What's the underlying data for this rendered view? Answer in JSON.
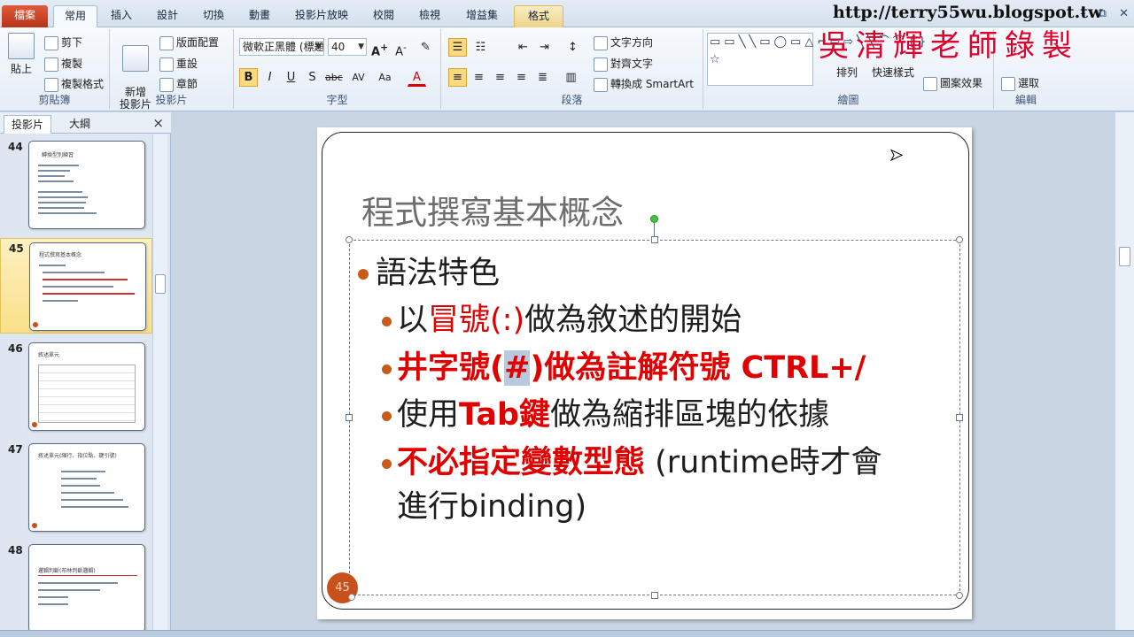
{
  "tabs": [
    "檔案",
    "常用",
    "插入",
    "設計",
    "切換",
    "動畫",
    "投影片放映",
    "校閱",
    "檢視",
    "增益集",
    "格式"
  ],
  "window_controls": [
    "–",
    "⧉",
    "✕"
  ],
  "watermark": {
    "url": "http://terry55wu.blogspot.tw",
    "name": "吳清輝老師錄製"
  },
  "ribbon": {
    "clipboard": {
      "label": "剪貼簿",
      "paste": "貼上",
      "cut": "剪下",
      "copy": "複製",
      "format_painter": "複製格式"
    },
    "slides": {
      "label": "投影片",
      "new_slide": "新增\n投影片",
      "layout": "版面配置",
      "reset": "重設",
      "section": "章節"
    },
    "font": {
      "label": "字型",
      "font_name": "微軟正黑體 (標題",
      "font_size": "40",
      "buttons": [
        "B",
        "I",
        "U",
        "S",
        "abc",
        "AV",
        "Aa",
        "A"
      ]
    },
    "paragraph": {
      "label": "段落",
      "text_direction": "文字方向",
      "align_text": "對齊文字",
      "smartart": "轉換成 SmartArt"
    },
    "drawing": {
      "label": "繪圖",
      "shapes": "▭▭╲╲▭◯▭△⌐⇨⇨╲╲⌒⌒{}☆",
      "arrange": "排列",
      "quick_styles": "快速樣式",
      "shape_effects": "圖案效果"
    },
    "editing": {
      "label": "編輯",
      "select": "選取"
    }
  },
  "left_panel": {
    "tabs": [
      "投影片",
      "大綱"
    ],
    "close": "×",
    "thumbnails": [
      {
        "num": "44",
        "title": "轉換型別練習"
      },
      {
        "num": "45",
        "title": "程式撰寫基本概念"
      },
      {
        "num": "46",
        "title": "敘述單元"
      },
      {
        "num": "47",
        "title": "敘述單元(縮行、指位點、鍵引號)"
      },
      {
        "num": "48",
        "title": "邏輯判斷(布林判斷邏輯)"
      }
    ]
  },
  "slide": {
    "title": "程式撰寫基本概念",
    "bullets": {
      "l1": "語法特色",
      "b1_pre": "以",
      "b1_red": "冒號(:)",
      "b1_post": "做為敘述的開始",
      "b2_pre": "井字號(",
      "b2_sel": "#",
      "b2_post": ")做為註解符號 CTRL+/",
      "b3_pre": "使用",
      "b3_red": "Tab鍵",
      "b3_post": "做為縮排區塊的依據",
      "b4_red": "不必指定變數型態",
      "b4_post": " (runtime時才會",
      "b4_cont": "進行binding)"
    },
    "number": "45"
  },
  "colors": {
    "accent": "#c8501a",
    "highlight_red": "#e00000",
    "file_tab": "#c8401f"
  }
}
